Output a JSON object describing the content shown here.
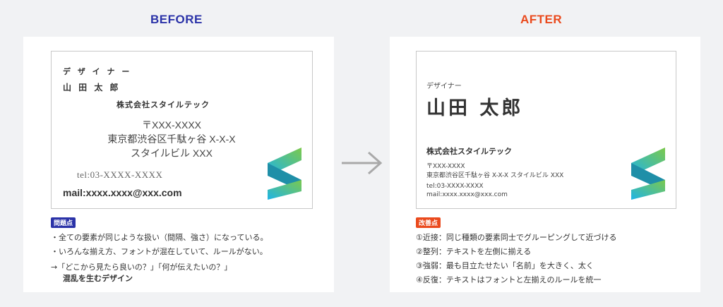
{
  "headings": {
    "before": "BEFORE",
    "after": "AFTER"
  },
  "colors": {
    "before": "#2b33a8",
    "after": "#ea4a1d",
    "arrow": "#a9a9a9"
  },
  "before": {
    "card": {
      "title": "デ ザ イ ナ ー",
      "name": "山 田  太 郎",
      "company": "株式会社スタイルテック",
      "address_lines": [
        "〒XXX-XXXX",
        "東京都渋谷区千駄ヶ谷 X-X-X",
        "スタイルビル XXX"
      ],
      "tel": "tel:03-XXXX-XXXX",
      "mail": "mail:xxxx.xxxx@xxx.com"
    },
    "badge": "問題点",
    "notes": [
      "・全ての要素が同じような扱い（間隔、強さ）になっている。",
      "・いろんな揃え方、フォントが混在していて、ルールがない。",
      "→「どこから見たら良いの？」「何が伝えたいの？」",
      "混乱を生むデザイン"
    ]
  },
  "after": {
    "card": {
      "title": "デザイナー",
      "name": "山田 太郎",
      "company": "株式会社スタイルテック",
      "postal": "〒XXX-XXXX",
      "address": "東京都渋谷区千駄ヶ谷 X-X-X スタイルビル XXX",
      "tel": "tel:03-XXXX-XXXX",
      "mail": "mail:xxxx.xxxx@xxx.com"
    },
    "badge": "改善点",
    "points": [
      "①近接：同じ種類の要素同士でグルーピングして近づける",
      "②整列：テキストを左側に揃える",
      "③強弱：最も目立たせたい「名前」を大きく、太く",
      "④反復：テキストはフォントと左揃えのルールを統一"
    ]
  }
}
